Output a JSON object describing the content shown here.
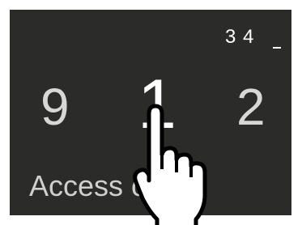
{
  "pin_entry": {
    "entered_digits": "3 4"
  },
  "picker": {
    "left_digit": "9",
    "center_digit": "1",
    "right_digit": "2"
  },
  "footer": {
    "label": "Access c"
  },
  "colors": {
    "background": "#2b2b29",
    "text_primary": "#ffffff",
    "text_secondary": "#d7d7d7"
  },
  "icons": {
    "gesture": "tap-hand-icon"
  }
}
